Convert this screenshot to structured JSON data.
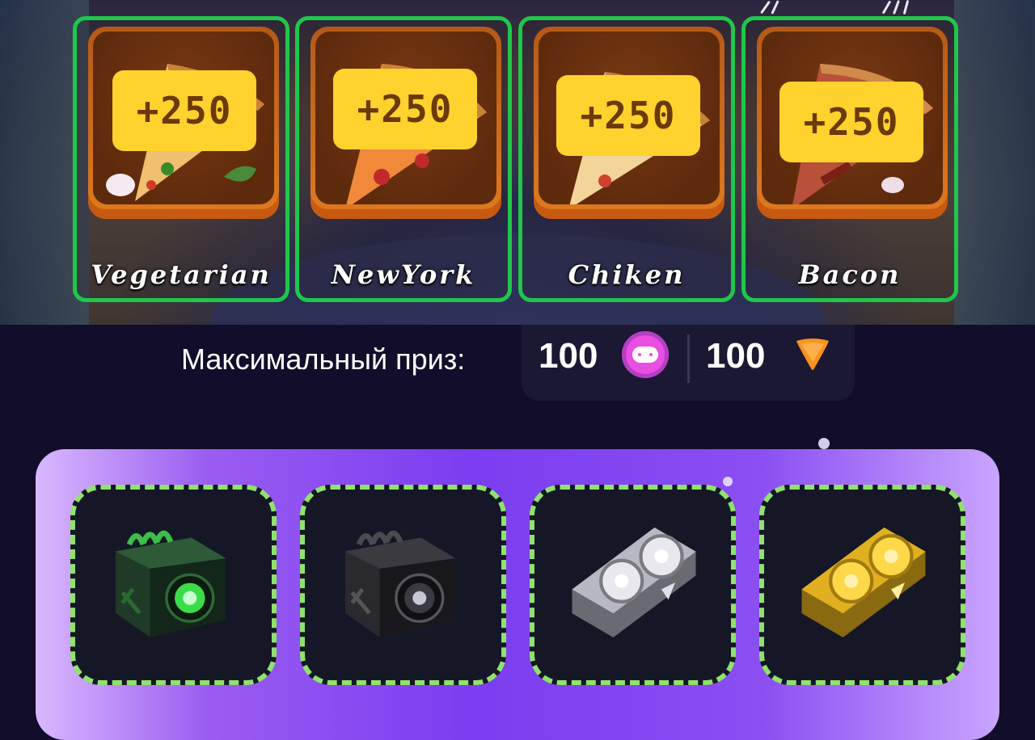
{
  "pizzas": [
    {
      "name": "Vegetarian",
      "bonus": "+250"
    },
    {
      "name": "NewYork",
      "bonus": "+250"
    },
    {
      "name": "Chiken",
      "bonus": "+250"
    },
    {
      "name": "Bacon",
      "bonus": "+250"
    }
  ],
  "prize": {
    "label": "Максимальный приз:",
    "coins": "100",
    "gems": "100",
    "coin_icon": "gamepad-coin-icon",
    "gem_icon": "orange-gem-icon"
  },
  "rewards": [
    {
      "icon": "green-miner-icon"
    },
    {
      "icon": "black-miner-icon"
    },
    {
      "icon": "silver-gpu-icon"
    },
    {
      "icon": "gold-gpu-icon"
    }
  ],
  "colors": {
    "card_border": "#1fc74a",
    "bonus_bg": "#ffd22e",
    "slot_border": "#8fe36d",
    "panel_accent": "#7b3df0",
    "coin": "#e94fe0",
    "gem": "#f7931e"
  }
}
